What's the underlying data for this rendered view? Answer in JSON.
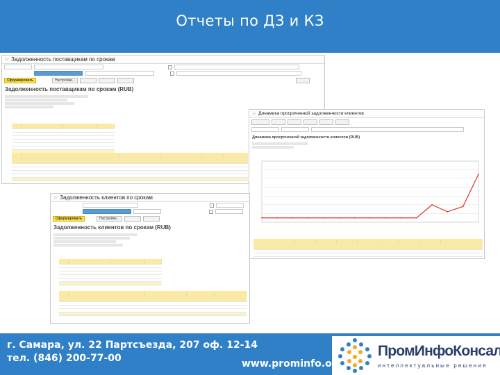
{
  "slide": {
    "title": "Отчеты по ДЗ и КЗ"
  },
  "footer": {
    "address_line1": "г. Самара, ул. 22 Партсъезда, 207 оф. 12-14",
    "address_line2": "тел. (846) 200-77-00",
    "website": "www.prominfo.org",
    "logo_name": "ПромИнфоКонсалт",
    "logo_tagline": "интеллектуальные решения"
  },
  "window1": {
    "title": "Задолженность поставщикам по срокам",
    "report_title": "Задолженность поставщикам по срокам (RUB)",
    "form_button": "Сформировать",
    "settings_button": "Настройки..."
  },
  "window2": {
    "title": "Динамика просроченной задолженности клиентов",
    "chart_title": "Динамика просроченной задолженности клиентов (RUB)"
  },
  "window3": {
    "title": "Задолженность клиентов по срокам",
    "report_title": "Задолженность клиентов по срокам (RUB)",
    "form_button": "Сформировать",
    "settings_button": "Настройки..."
  },
  "chart_data": {
    "type": "line",
    "title": "",
    "series": [
      {
        "values": [
          5,
          5,
          5,
          5,
          5,
          5,
          5,
          5,
          5,
          5,
          5,
          20,
          12,
          18,
          55
        ]
      }
    ],
    "ylim": [
      0,
      70
    ],
    "grid": true
  },
  "colors": {
    "brand_blue": "#2f80c6",
    "primary_button": "#fbe14c",
    "line_red": "#e0322f",
    "table_header": "#fbeaa0"
  }
}
